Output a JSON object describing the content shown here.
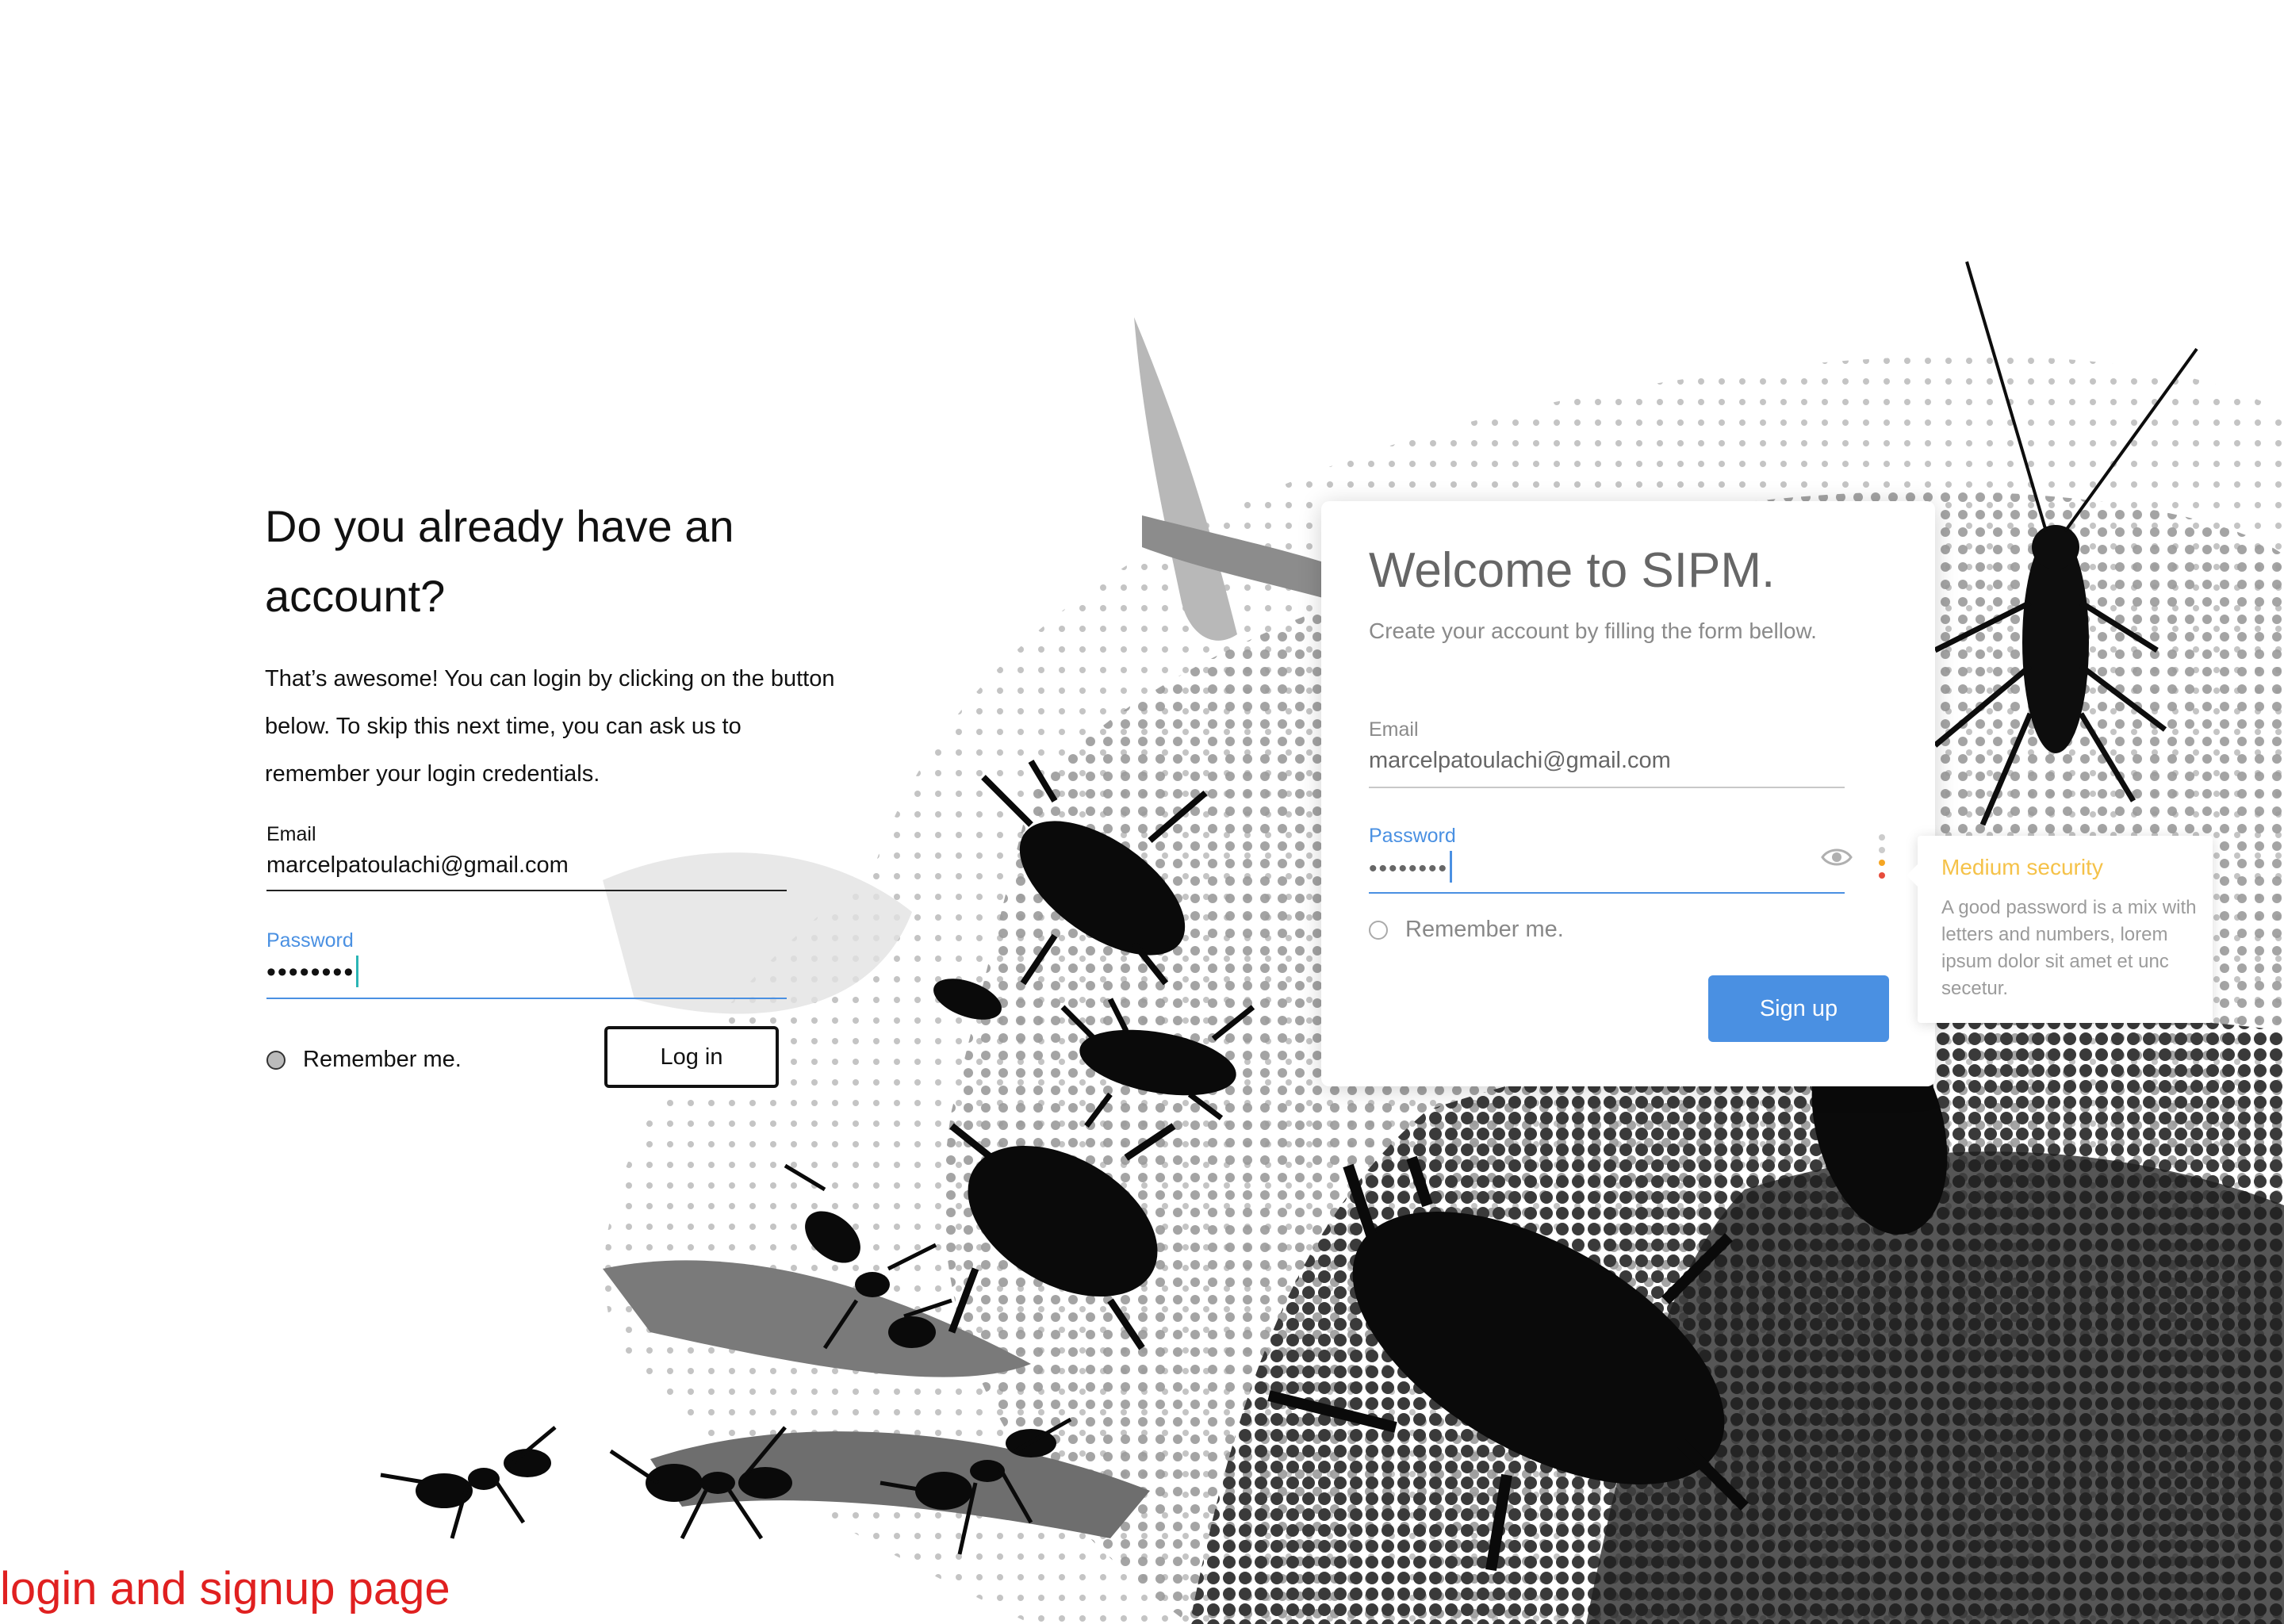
{
  "login": {
    "heading": "Do you already have an account?",
    "description": "That’s awesome! You can login by clicking on the button below. To skip this next time, you can ask us to remember your login credentials.",
    "email_label": "Email",
    "email_value": "marcelpatoulachi@gmail.com",
    "password_label": "Password",
    "password_value": "••••••••",
    "remember_label": "Remember me.",
    "login_button": "Log in"
  },
  "signup": {
    "title": "Welcome to SIPM.",
    "subtitle": "Create your account by filling the form bellow.",
    "email_label": "Email",
    "email_value": "marcelpatoulachi@gmail.com",
    "password_label": "Password",
    "password_value": "••••••••",
    "remember_label": "Remember me.",
    "signup_button": "Sign up"
  },
  "security_tooltip": {
    "title": "Medium security",
    "body": "A good password is a mix with letters and numbers, lorem ipsum dolor sit amet et unc secetur."
  },
  "caption": "login and signup page",
  "icons": [
    "eye-icon",
    "strength-indicator-icon",
    "radio-icon"
  ],
  "colors": {
    "accent": "#4a90e2",
    "caption": "#e02020",
    "warning": "#f5c249",
    "strength_dots": [
      "#cccccc",
      "#f5a623",
      "#e74c3c"
    ]
  }
}
